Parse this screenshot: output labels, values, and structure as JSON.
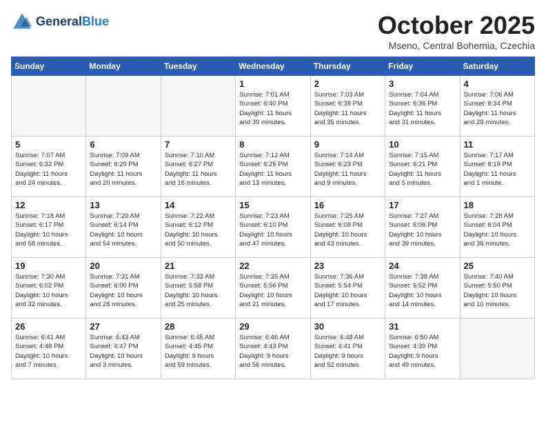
{
  "header": {
    "logo_line1": "General",
    "logo_line2": "Blue",
    "month_title": "October 2025",
    "location": "Mseno, Central Bohemia, Czechia"
  },
  "days_of_week": [
    "Sunday",
    "Monday",
    "Tuesday",
    "Wednesday",
    "Thursday",
    "Friday",
    "Saturday"
  ],
  "weeks": [
    [
      {
        "day": "",
        "info": "",
        "empty": true
      },
      {
        "day": "",
        "info": "",
        "empty": true
      },
      {
        "day": "",
        "info": "",
        "empty": true
      },
      {
        "day": "1",
        "info": "Sunrise: 7:01 AM\nSunset: 6:40 PM\nDaylight: 11 hours\nand 39 minutes.",
        "empty": false
      },
      {
        "day": "2",
        "info": "Sunrise: 7:03 AM\nSunset: 6:38 PM\nDaylight: 11 hours\nand 35 minutes.",
        "empty": false
      },
      {
        "day": "3",
        "info": "Sunrise: 7:04 AM\nSunset: 6:36 PM\nDaylight: 11 hours\nand 31 minutes.",
        "empty": false
      },
      {
        "day": "4",
        "info": "Sunrise: 7:06 AM\nSunset: 6:34 PM\nDaylight: 11 hours\nand 28 minutes.",
        "empty": false
      }
    ],
    [
      {
        "day": "5",
        "info": "Sunrise: 7:07 AM\nSunset: 6:32 PM\nDaylight: 11 hours\nand 24 minutes.",
        "empty": false
      },
      {
        "day": "6",
        "info": "Sunrise: 7:09 AM\nSunset: 6:29 PM\nDaylight: 11 hours\nand 20 minutes.",
        "empty": false
      },
      {
        "day": "7",
        "info": "Sunrise: 7:10 AM\nSunset: 6:27 PM\nDaylight: 11 hours\nand 16 minutes.",
        "empty": false
      },
      {
        "day": "8",
        "info": "Sunrise: 7:12 AM\nSunset: 6:25 PM\nDaylight: 11 hours\nand 13 minutes.",
        "empty": false
      },
      {
        "day": "9",
        "info": "Sunrise: 7:14 AM\nSunset: 6:23 PM\nDaylight: 11 hours\nand 9 minutes.",
        "empty": false
      },
      {
        "day": "10",
        "info": "Sunrise: 7:15 AM\nSunset: 6:21 PM\nDaylight: 11 hours\nand 5 minutes.",
        "empty": false
      },
      {
        "day": "11",
        "info": "Sunrise: 7:17 AM\nSunset: 6:19 PM\nDaylight: 11 hours\nand 1 minute.",
        "empty": false
      }
    ],
    [
      {
        "day": "12",
        "info": "Sunrise: 7:18 AM\nSunset: 6:17 PM\nDaylight: 10 hours\nand 58 minutes.",
        "empty": false
      },
      {
        "day": "13",
        "info": "Sunrise: 7:20 AM\nSunset: 6:14 PM\nDaylight: 10 hours\nand 54 minutes.",
        "empty": false
      },
      {
        "day": "14",
        "info": "Sunrise: 7:22 AM\nSunset: 6:12 PM\nDaylight: 10 hours\nand 50 minutes.",
        "empty": false
      },
      {
        "day": "15",
        "info": "Sunrise: 7:23 AM\nSunset: 6:10 PM\nDaylight: 10 hours\nand 47 minutes.",
        "empty": false
      },
      {
        "day": "16",
        "info": "Sunrise: 7:25 AM\nSunset: 6:08 PM\nDaylight: 10 hours\nand 43 minutes.",
        "empty": false
      },
      {
        "day": "17",
        "info": "Sunrise: 7:27 AM\nSunset: 6:06 PM\nDaylight: 10 hours\nand 39 minutes.",
        "empty": false
      },
      {
        "day": "18",
        "info": "Sunrise: 7:28 AM\nSunset: 6:04 PM\nDaylight: 10 hours\nand 36 minutes.",
        "empty": false
      }
    ],
    [
      {
        "day": "19",
        "info": "Sunrise: 7:30 AM\nSunset: 6:02 PM\nDaylight: 10 hours\nand 32 minutes.",
        "empty": false
      },
      {
        "day": "20",
        "info": "Sunrise: 7:31 AM\nSunset: 6:00 PM\nDaylight: 10 hours\nand 28 minutes.",
        "empty": false
      },
      {
        "day": "21",
        "info": "Sunrise: 7:33 AM\nSunset: 5:58 PM\nDaylight: 10 hours\nand 25 minutes.",
        "empty": false
      },
      {
        "day": "22",
        "info": "Sunrise: 7:35 AM\nSunset: 5:56 PM\nDaylight: 10 hours\nand 21 minutes.",
        "empty": false
      },
      {
        "day": "23",
        "info": "Sunrise: 7:36 AM\nSunset: 5:54 PM\nDaylight: 10 hours\nand 17 minutes.",
        "empty": false
      },
      {
        "day": "24",
        "info": "Sunrise: 7:38 AM\nSunset: 5:52 PM\nDaylight: 10 hours\nand 14 minutes.",
        "empty": false
      },
      {
        "day": "25",
        "info": "Sunrise: 7:40 AM\nSunset: 5:50 PM\nDaylight: 10 hours\nand 10 minutes.",
        "empty": false
      }
    ],
    [
      {
        "day": "26",
        "info": "Sunrise: 6:41 AM\nSunset: 4:48 PM\nDaylight: 10 hours\nand 7 minutes.",
        "empty": false
      },
      {
        "day": "27",
        "info": "Sunrise: 6:43 AM\nSunset: 4:47 PM\nDaylight: 10 hours\nand 3 minutes.",
        "empty": false
      },
      {
        "day": "28",
        "info": "Sunrise: 6:45 AM\nSunset: 4:45 PM\nDaylight: 9 hours\nand 59 minutes.",
        "empty": false
      },
      {
        "day": "29",
        "info": "Sunrise: 6:46 AM\nSunset: 4:43 PM\nDaylight: 9 hours\nand 56 minutes.",
        "empty": false
      },
      {
        "day": "30",
        "info": "Sunrise: 6:48 AM\nSunset: 4:41 PM\nDaylight: 9 hours\nand 52 minutes.",
        "empty": false
      },
      {
        "day": "31",
        "info": "Sunrise: 6:50 AM\nSunset: 4:39 PM\nDaylight: 9 hours\nand 49 minutes.",
        "empty": false
      },
      {
        "day": "",
        "info": "",
        "empty": true
      }
    ]
  ]
}
